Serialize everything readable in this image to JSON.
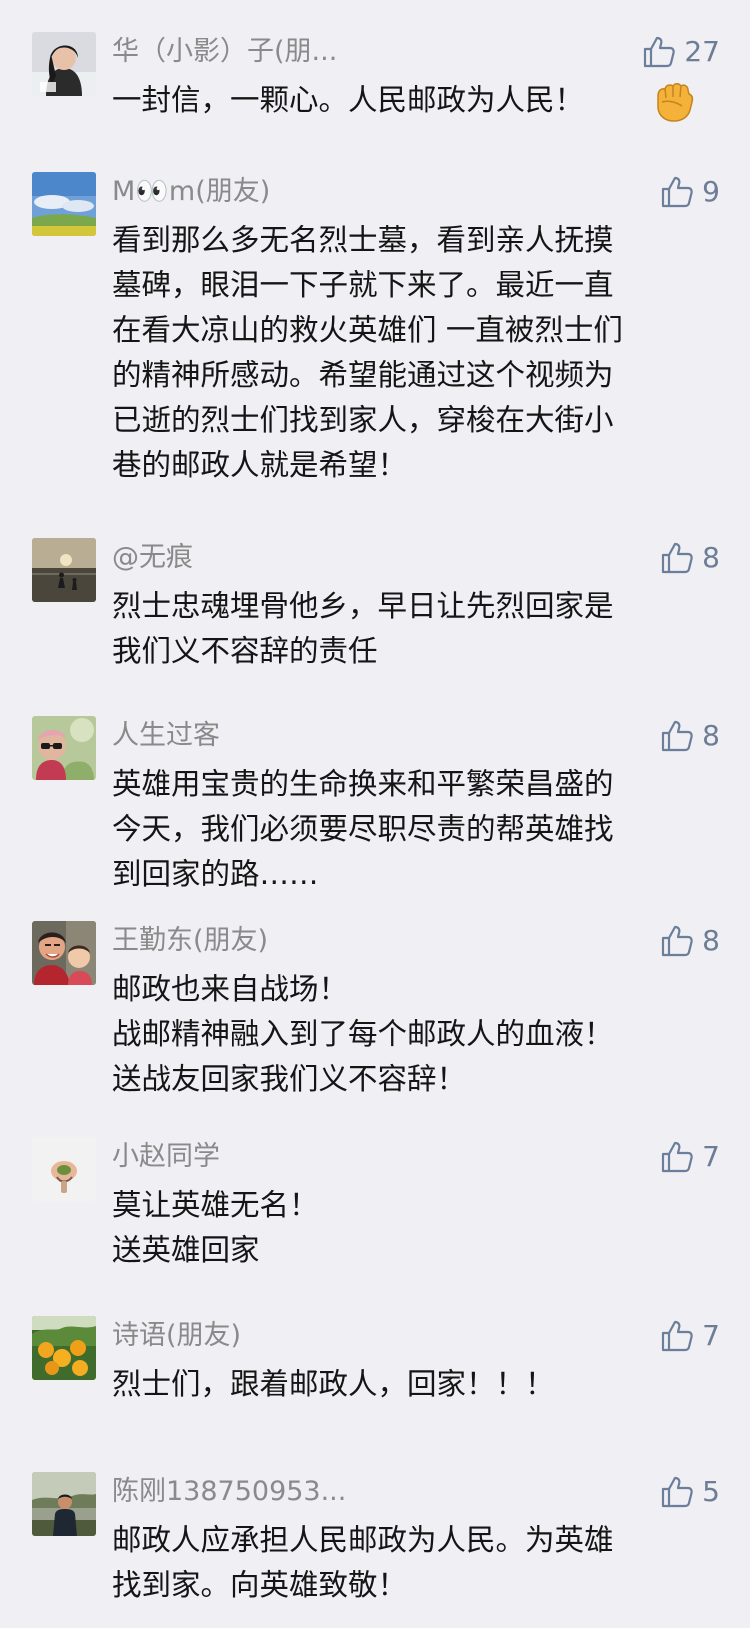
{
  "colors": {
    "background": "#efeff4",
    "username": "#8a8a8a",
    "like_count": "#6d7d96",
    "like_icon": "#6b7e9a",
    "comment_text": "#151515"
  },
  "comments": [
    {
      "username": "华（小影）子(朋...",
      "avatar_icon": "person-photo-avatar",
      "likes": "27",
      "lines": [
        "一封信，一颗心。人民邮政为人民！"
      ],
      "emoji": "raised-fist-emoji"
    },
    {
      "username": "M👀m(朋友)",
      "avatar_icon": "sky-landscape-avatar",
      "likes": "9",
      "lines": [
        "看到那么多无名烈士墓，看到亲人抚摸",
        "墓碑，眼泪一下子就下来了。最近一直",
        "在看大凉山的救火英雄们 一直被烈士们",
        "的精神所感动。希望能通过这个视频为",
        "已逝的烈士们找到家人，穿梭在大街小",
        "巷的邮政人就是希望！"
      ]
    },
    {
      "username": "@无痕",
      "avatar_icon": "sunset-beach-avatar",
      "likes": "8",
      "lines": [
        "烈士忠魂埋骨他乡，早日让先烈回家是",
        "我们义不容辞的责任"
      ]
    },
    {
      "username": "人生过客",
      "avatar_icon": "sunglasses-person-avatar",
      "likes": "8",
      "lines": [
        "英雄用宝贵的生命换来和平繁荣昌盛的",
        "今天，我们必须要尽职尽责的帮英雄找",
        "到回家的路……"
      ]
    },
    {
      "username": "王勤东(朋友)",
      "avatar_icon": "family-photo-avatar",
      "likes": "8",
      "lines": [
        "邮政也来自战场！",
        "战邮精神融入到了每个邮政人的血液！",
        "送战友回家我们义不容辞！"
      ]
    },
    {
      "username": "小赵同学",
      "avatar_icon": "cartoon-avatar",
      "likes": "7",
      "lines": [
        "莫让英雄无名！",
        "送英雄回家"
      ]
    },
    {
      "username": "诗语(朋友)",
      "avatar_icon": "fruit-tree-avatar",
      "likes": "7",
      "lines": [
        "烈士们，跟着邮政人，回家！！！"
      ]
    },
    {
      "username": "陈刚138750953...",
      "avatar_icon": "man-standing-avatar",
      "likes": "5",
      "lines": [
        "邮政人应承担人民邮政为人民。为英雄",
        "找到家。向英雄致敬！"
      ]
    }
  ]
}
